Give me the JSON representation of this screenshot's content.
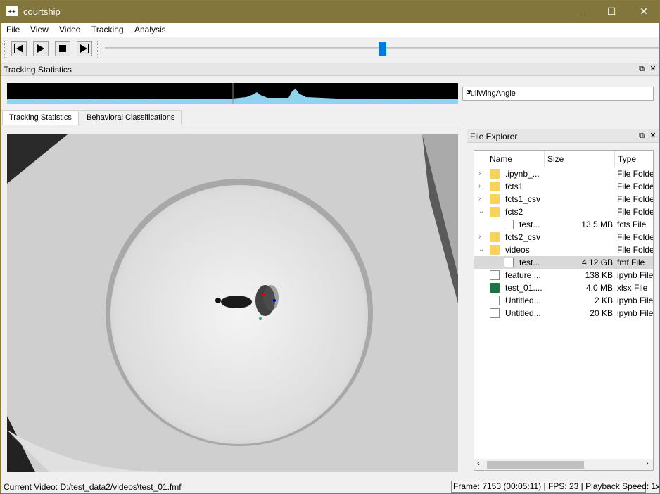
{
  "window": {
    "title": "courtship",
    "minimize": "—",
    "maximize": "☐",
    "close": "✕"
  },
  "menubar": {
    "items": [
      "File",
      "View",
      "Video",
      "Tracking",
      "Analysis"
    ]
  },
  "toolbar": {
    "buttons": [
      "previous-frame",
      "play",
      "stop",
      "next-frame"
    ],
    "slider_position": 0.5
  },
  "tracking_dock": {
    "title": "Tracking Statistics",
    "metric_select": "FullWingAngle",
    "strip_accent": "#8fd4ee"
  },
  "tabs": [
    {
      "label": "Tracking Statistics",
      "active": true
    },
    {
      "label": "Behavioral Classifications",
      "active": false
    }
  ],
  "file_explorer": {
    "title": "File Explorer",
    "columns": [
      "Name",
      "Size",
      "Type"
    ],
    "rows": [
      {
        "name": ".ipynb_...",
        "size": "",
        "type": "File Folde",
        "kind": "folder",
        "expander": "›",
        "indent": 0
      },
      {
        "name": "fcts1",
        "size": "",
        "type": "File Folde",
        "kind": "folder",
        "expander": "›",
        "indent": 0
      },
      {
        "name": "fcts1_csv",
        "size": "",
        "type": "File Folde",
        "kind": "folder",
        "expander": "›",
        "indent": 0
      },
      {
        "name": "fcts2",
        "size": "",
        "type": "File Folde",
        "kind": "folder",
        "expander": "⌄",
        "indent": 0
      },
      {
        "name": "test...",
        "size": "13.5 MB",
        "type": "fcts File",
        "kind": "file",
        "expander": "",
        "indent": 1
      },
      {
        "name": "fcts2_csv",
        "size": "",
        "type": "File Folde",
        "kind": "folder",
        "expander": "›",
        "indent": 0
      },
      {
        "name": "videos",
        "size": "",
        "type": "File Folde",
        "kind": "folder",
        "expander": "⌄",
        "indent": 0
      },
      {
        "name": "test...",
        "size": "4.12 GB",
        "type": "fmf File",
        "kind": "file",
        "expander": "",
        "indent": 1,
        "selected": true
      },
      {
        "name": "feature ...",
        "size": "138 KB",
        "type": "ipynb File",
        "kind": "file",
        "expander": "",
        "indent": 0
      },
      {
        "name": "test_01....",
        "size": "4.0 MB",
        "type": "xlsx File",
        "kind": "xlsx",
        "expander": "",
        "indent": 0
      },
      {
        "name": "Untitled...",
        "size": "2 KB",
        "type": "ipynb File",
        "kind": "file",
        "expander": "",
        "indent": 0
      },
      {
        "name": "Untitled...",
        "size": "20 KB",
        "type": "ipynb File",
        "kind": "file",
        "expander": "",
        "indent": 0
      }
    ]
  },
  "status": {
    "current_video": "Current Video: D:/test_data2/videos\\test_01.fmf",
    "frame_info": "Frame: 7153 (00:05:11) | FPS: 23 | Playback Speed: 1x"
  },
  "colors": {
    "titlebar": "#83763c",
    "accent": "#0078d7"
  }
}
